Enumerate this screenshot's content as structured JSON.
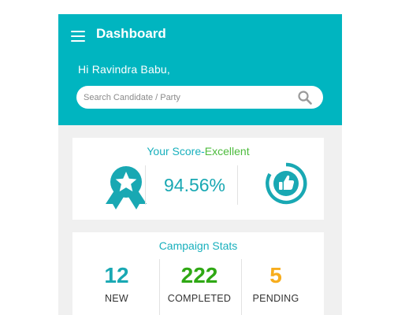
{
  "header": {
    "title": "Dashboard",
    "greeting": "Hi Ravindra Babu,",
    "search_placeholder": "Search Candidate / Party"
  },
  "score_card": {
    "title_prefix": "Your Score-",
    "rating": "Excellent",
    "score": "94.56%",
    "badge_icon": "ribbon-star-badge-icon",
    "thumb_icon": "thumbs-up-icon"
  },
  "campaign_stats": {
    "title": "Campaign Stats",
    "items": [
      {
        "value": "12",
        "label": "NEW",
        "color": "#19a8b3"
      },
      {
        "value": "222",
        "label": "COMPLETED",
        "color": "#2fa814"
      },
      {
        "value": "5",
        "label": "PENDING",
        "color": "#f7ad1d"
      }
    ]
  },
  "colors": {
    "brand": "#00b5c0",
    "accent_teal": "#19b0bd",
    "excellent_green": "#4cbb3c",
    "background": "#f0f0f0"
  }
}
